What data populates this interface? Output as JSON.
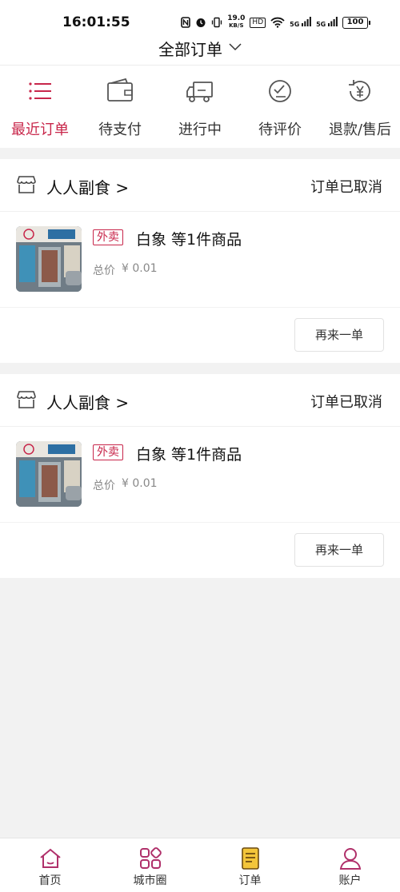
{
  "status_bar": {
    "time": "16:01:55",
    "speed_value": "19.0",
    "speed_unit": "KB/S",
    "hd": "HD",
    "signal1": "5G",
    "signal2": "5G",
    "battery": "100"
  },
  "header": {
    "title": "全部订单"
  },
  "tabs": [
    {
      "label": "最近订单",
      "icon": "list-icon",
      "active": true
    },
    {
      "label": "待支付",
      "icon": "wallet-icon",
      "active": false
    },
    {
      "label": "进行中",
      "icon": "truck-icon",
      "active": false
    },
    {
      "label": "待评价",
      "icon": "review-icon",
      "active": false
    },
    {
      "label": "退款/售后",
      "icon": "refund-icon",
      "active": false
    }
  ],
  "orders": [
    {
      "shop_name": "人人副食 >",
      "status": "订单已取消",
      "badge": "外卖",
      "item_title": "白象 等1件商品",
      "price_label": "总价",
      "price": "¥ 0.01",
      "reorder_label": "再来一单"
    },
    {
      "shop_name": "人人副食 >",
      "status": "订单已取消",
      "badge": "外卖",
      "item_title": "白象 等1件商品",
      "price_label": "总价",
      "price": "¥ 0.01",
      "reorder_label": "再来一单"
    }
  ],
  "bottom_nav": [
    {
      "label": "首页",
      "icon": "home-icon"
    },
    {
      "label": "城市圈",
      "icon": "city-circle-icon"
    },
    {
      "label": "订单",
      "icon": "order-doc-icon"
    },
    {
      "label": "账户",
      "icon": "account-icon"
    }
  ],
  "colors": {
    "accent": "#c8264a",
    "background": "#f2f2f2"
  }
}
